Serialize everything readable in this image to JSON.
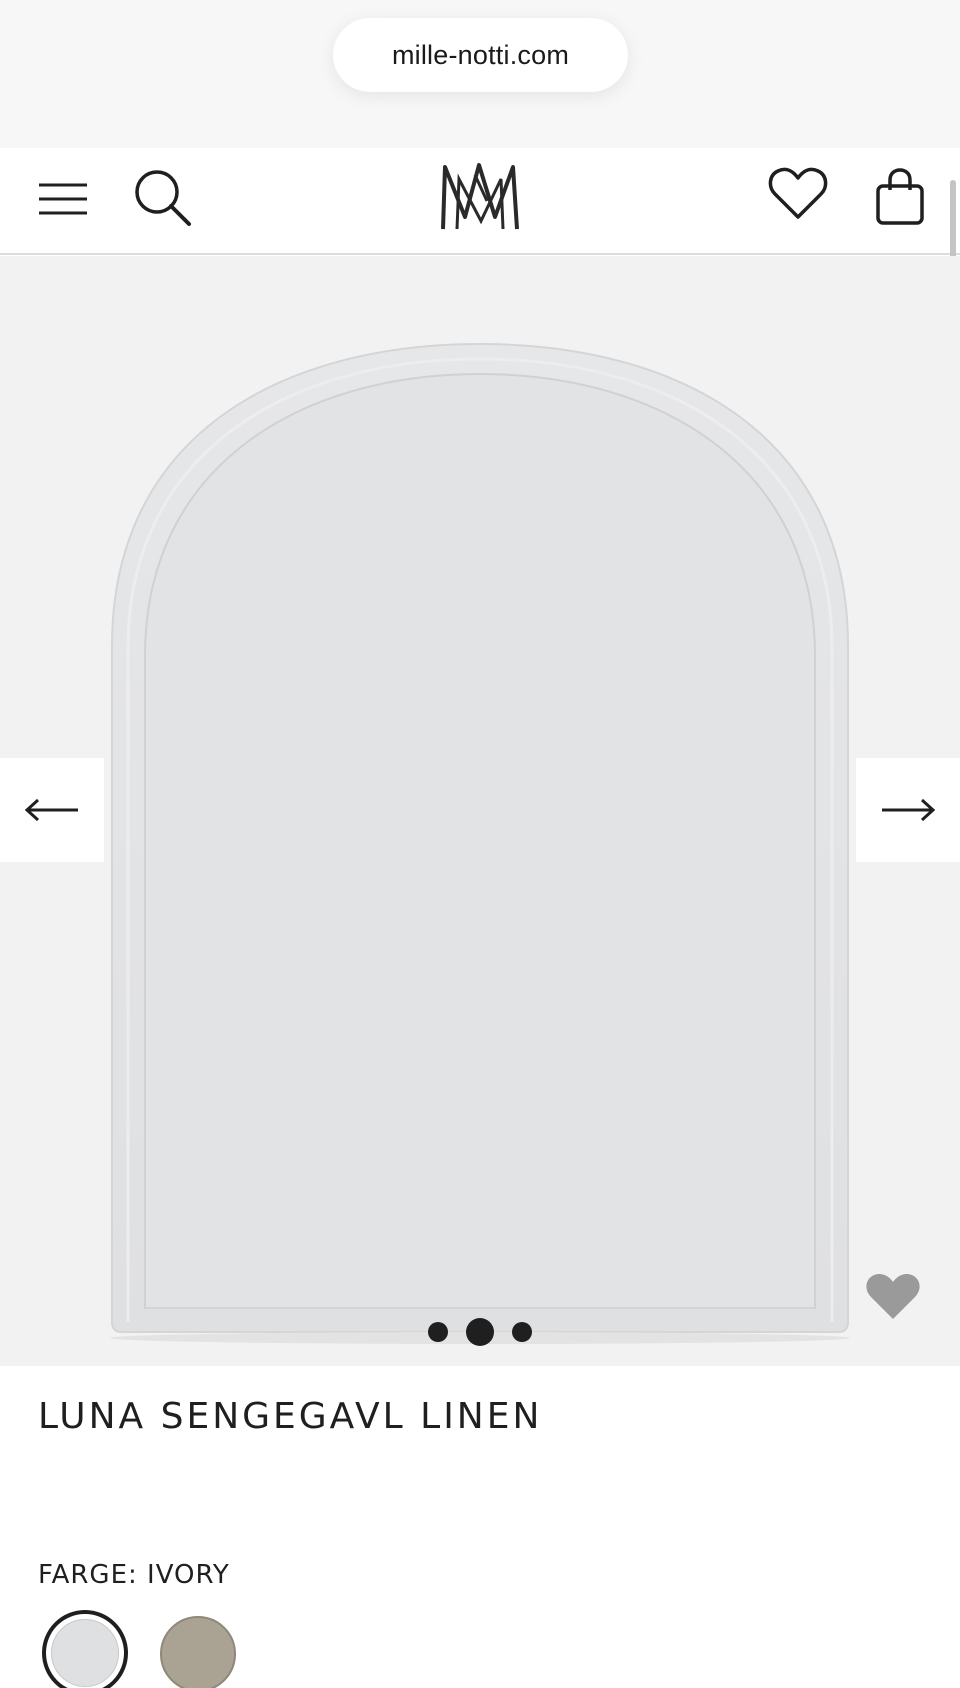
{
  "browser": {
    "url": "mille-notti.com"
  },
  "header": {
    "menu_icon": "hamburger-menu-icon",
    "search_icon": "search-icon",
    "logo_icon": "mille-notti-monogram-logo",
    "wishlist_icon": "heart-outline-icon",
    "cart_icon": "shopping-bag-icon"
  },
  "gallery": {
    "prev_icon": "arrow-left-icon",
    "next_icon": "arrow-right-icon",
    "favorite_icon": "heart-filled-icon",
    "slide_count": 3,
    "active_slide": 2,
    "background": "#f2f2f2",
    "product_color": "#e4e5e7"
  },
  "product": {
    "title": "LUNA SENGEGAVL LINEN",
    "color_label": "FARGE:",
    "color_value": "IVORY",
    "swatches": [
      {
        "name": "ivory",
        "color": "#dfe0e2",
        "selected": true
      },
      {
        "name": "sand",
        "color": "#aaa393",
        "selected": false
      }
    ]
  }
}
